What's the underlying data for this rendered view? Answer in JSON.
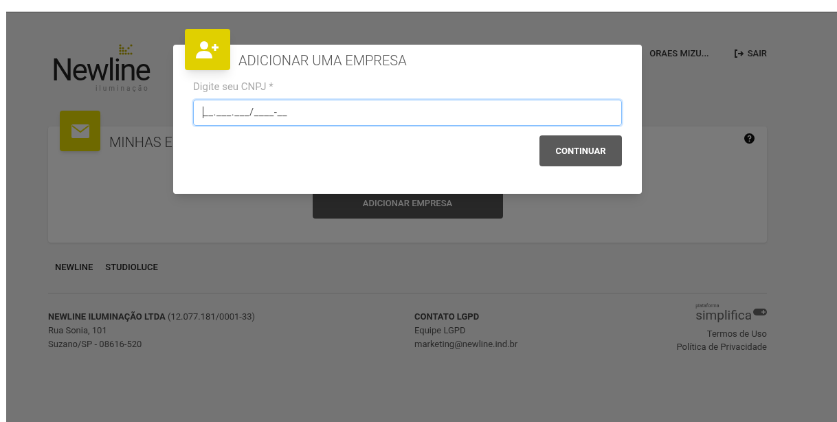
{
  "header": {
    "logo": {
      "name": "Newline",
      "tagline": "iluminação"
    },
    "user_name": "ORAES MIZU...",
    "logout": "SAIR"
  },
  "card": {
    "title": "MINHAS E",
    "add_button": "ADICIONAR EMPRESA"
  },
  "nav_links": [
    "NEWLINE",
    "STUDIOLUCE"
  ],
  "footer": {
    "company": {
      "name": "NEWLINE ILUMINAÇÃO LTDA",
      "cnpj": "(12.077.181/0001-33)",
      "lines": [
        "Rua Sonia, 101",
        "Suzano/SP - 08616-520"
      ]
    },
    "contact": {
      "title": "CONTATO LGPD",
      "lines": [
        "Equipe LGPD",
        "marketing@newline.ind.br"
      ]
    },
    "brand": {
      "small": "plataforma",
      "name": "simplifica"
    },
    "links": [
      "Termos de Uso",
      "Política de Privacidade"
    ]
  },
  "modal": {
    "title": "ADICIONAR UMA EMPRESA",
    "field": {
      "label": "Digite seu CNPJ *",
      "value": "__.___.___/____-__",
      "focused": true
    },
    "button": "CONTINUAR"
  }
}
